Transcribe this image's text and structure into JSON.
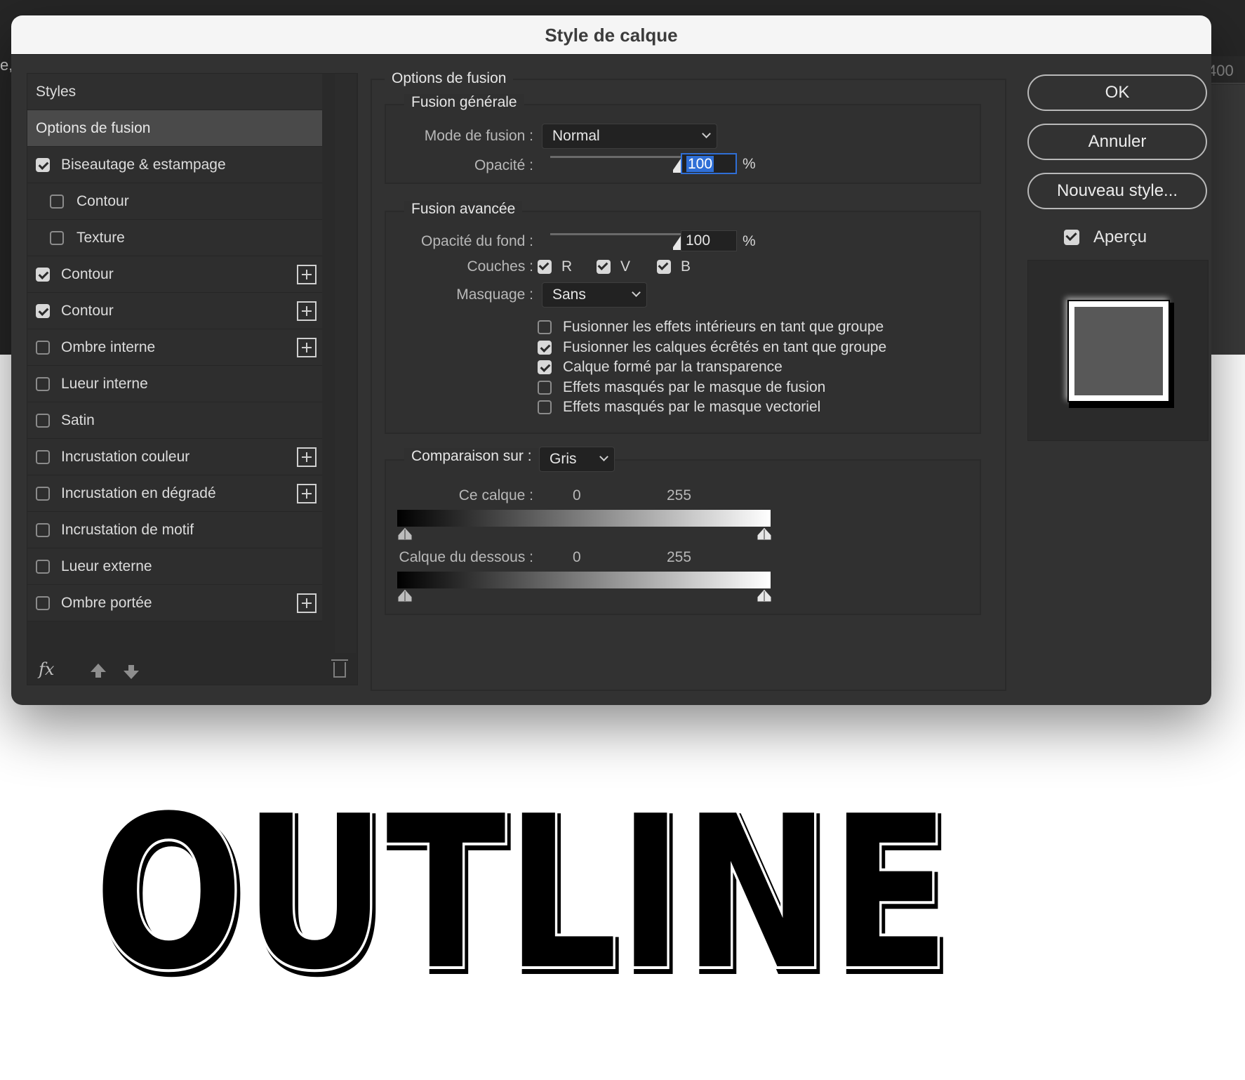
{
  "dialog": {
    "title": "Style de calque"
  },
  "background": {
    "left_edge_text": "e,",
    "ruler_text": "400"
  },
  "styles_panel": {
    "header": "Styles",
    "selected": "Options de fusion",
    "items": [
      {
        "label": "Biseautage & estampage",
        "checked": true,
        "sub": false,
        "plus": false
      },
      {
        "label": "Contour",
        "checked": false,
        "sub": true,
        "plus": false
      },
      {
        "label": "Texture",
        "checked": false,
        "sub": true,
        "plus": false
      },
      {
        "label": "Contour",
        "checked": true,
        "sub": false,
        "plus": true
      },
      {
        "label": "Contour",
        "checked": true,
        "sub": false,
        "plus": true
      },
      {
        "label": "Ombre interne",
        "checked": false,
        "sub": false,
        "plus": true
      },
      {
        "label": "Lueur interne",
        "checked": false,
        "sub": false,
        "plus": false
      },
      {
        "label": "Satin",
        "checked": false,
        "sub": false,
        "plus": false
      },
      {
        "label": "Incrustation couleur",
        "checked": false,
        "sub": false,
        "plus": true
      },
      {
        "label": "Incrustation en dégradé",
        "checked": false,
        "sub": false,
        "plus": true
      },
      {
        "label": "Incrustation de motif",
        "checked": false,
        "sub": false,
        "plus": false
      },
      {
        "label": "Lueur externe",
        "checked": false,
        "sub": false,
        "plus": false
      },
      {
        "label": "Ombre portée",
        "checked": false,
        "sub": false,
        "plus": true
      }
    ],
    "footer": {
      "fx_label": "fx",
      "icons": [
        "fx-icon",
        "move-up-icon",
        "move-down-icon",
        "trash-icon"
      ]
    }
  },
  "blending": {
    "section_title": "Options de fusion",
    "general": {
      "title": "Fusion générale",
      "mode_label": "Mode de fusion :",
      "mode_value": "Normal",
      "opacity_label": "Opacité :",
      "opacity_value": "100",
      "opacity_level": 1.0,
      "pct": "%"
    },
    "advanced": {
      "title": "Fusion avancée",
      "fill_label": "Opacité du fond :",
      "fill_value": "100",
      "fill_level": 1.0,
      "pct": "%",
      "channels_label": "Couches :",
      "channels": [
        "R",
        "V",
        "B"
      ],
      "knockout_label": "Masquage :",
      "knockout_value": "Sans",
      "options": [
        {
          "label": "Fusionner les effets intérieurs en tant que groupe",
          "checked": false
        },
        {
          "label": "Fusionner les calques écrêtés en tant que groupe",
          "checked": true
        },
        {
          "label": "Calque formé par la transparence",
          "checked": true
        },
        {
          "label": "Effets masqués par le masque de fusion",
          "checked": false
        },
        {
          "label": "Effets masqués par le masque vectoriel",
          "checked": false
        }
      ]
    },
    "blend_if": {
      "label": "Comparaison sur :",
      "value": "Gris",
      "this_layer_label": "Ce calque :",
      "this_layer_min": "0",
      "this_layer_max": "255",
      "underlying_label": "Calque du dessous :",
      "underlying_min": "0",
      "underlying_max": "255"
    }
  },
  "buttons": {
    "ok": "OK",
    "cancel": "Annuler",
    "new_style": "Nouveau style...",
    "preview_label": "Aperçu"
  },
  "canvas": {
    "text": "OUTLINE"
  }
}
